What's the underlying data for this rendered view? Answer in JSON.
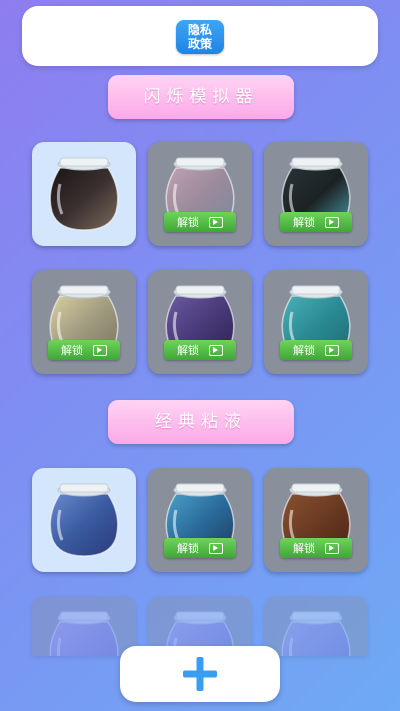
{
  "header": {
    "privacy_label": "隐私\n政策"
  },
  "sections": [
    {
      "title": "闪烁模拟器",
      "items": [
        {
          "name": "dark-face",
          "locked": false,
          "colors": [
            "#3a3030",
            "#1a1414",
            "#7a6a5a"
          ]
        },
        {
          "name": "glitter-rainbow",
          "locked": true,
          "colors": [
            "#9a8a9a",
            "#c0a0b0",
            "#7a8aa0"
          ]
        },
        {
          "name": "black-sparkle",
          "locked": true,
          "colors": [
            "#1c2224",
            "#2a3338",
            "#4aa0b0"
          ]
        },
        {
          "name": "gold-swirl",
          "locked": true,
          "colors": [
            "#a09a80",
            "#d8d0a0",
            "#7a7460"
          ]
        },
        {
          "name": "purple-glitter",
          "locked": true,
          "colors": [
            "#4a3a7a",
            "#6a5aa0",
            "#2a2250"
          ]
        },
        {
          "name": "teal-sand",
          "locked": true,
          "colors": [
            "#2a8a94",
            "#4ab0b8",
            "#1f6a72"
          ]
        }
      ]
    },
    {
      "title": "经典粘液",
      "items": [
        {
          "name": "blue-galaxy",
          "locked": false,
          "colors": [
            "#3a5aa0",
            "#6a8ad0",
            "#2a3a7a"
          ]
        },
        {
          "name": "blue-nebula",
          "locked": true,
          "colors": [
            "#2a6a9a",
            "#4aa0c8",
            "#1e3a5e"
          ]
        },
        {
          "name": "brown-beads",
          "locked": true,
          "colors": [
            "#6a3a22",
            "#8a5230",
            "#4a2414"
          ]
        }
      ]
    }
  ],
  "unlock_label": "解锁",
  "add_button": {
    "label": "+"
  }
}
